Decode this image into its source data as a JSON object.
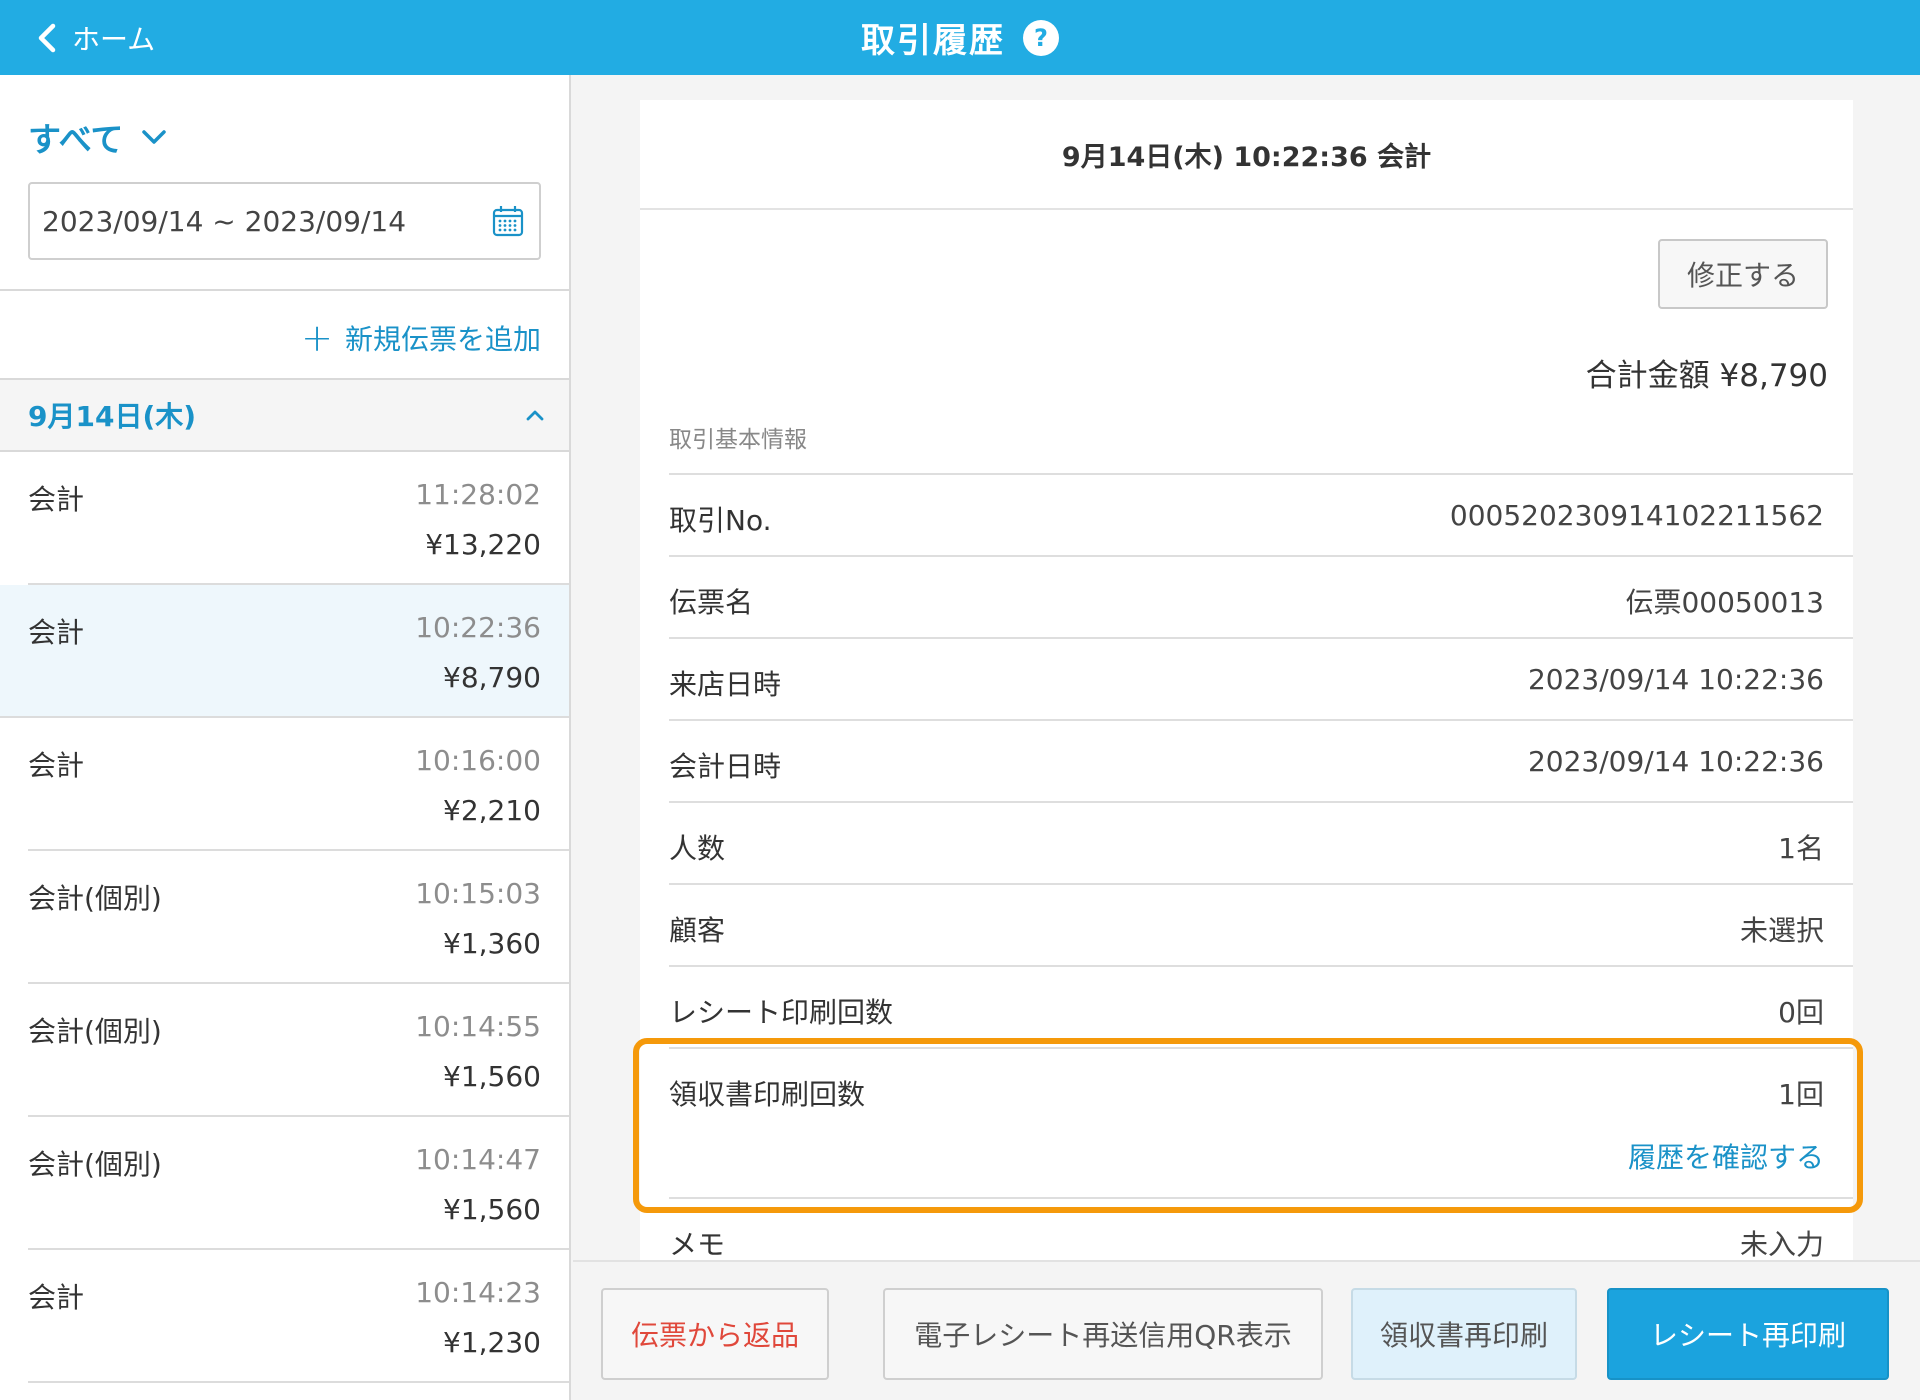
{
  "header": {
    "back_label": "ホーム",
    "title": "取引履歴",
    "help_symbol": "?"
  },
  "sidebar": {
    "filter_label": "すべて",
    "date_range": "2023/09/14 ~ 2023/09/14",
    "add_slip_label": "新規伝票を追加",
    "date_group_label": "9月14日(木)",
    "transactions": [
      {
        "name": "会計",
        "time": "11:28:02",
        "amount": "¥13,220",
        "selected": false
      },
      {
        "name": "会計",
        "time": "10:22:36",
        "amount": "¥8,790",
        "selected": true
      },
      {
        "name": "会計",
        "time": "10:16:00",
        "amount": "¥2,210",
        "selected": false
      },
      {
        "name": "会計(個別)",
        "time": "10:15:03",
        "amount": "¥1,360",
        "selected": false
      },
      {
        "name": "会計(個別)",
        "time": "10:14:55",
        "amount": "¥1,560",
        "selected": false
      },
      {
        "name": "会計(個別)",
        "time": "10:14:47",
        "amount": "¥1,560",
        "selected": false
      },
      {
        "name": "会計",
        "time": "10:14:23",
        "amount": "¥1,230",
        "selected": false
      }
    ]
  },
  "detail": {
    "title": "9月14日(木) 10:22:36 会計",
    "edit_label": "修正する",
    "total_label": "合計金額 ¥8,790",
    "section_label": "取引基本情報",
    "rows": [
      {
        "key": "取引No.",
        "value": "00052023091410221 1562"
      },
      {
        "key": "伝票名",
        "value": "伝票00050013"
      },
      {
        "key": "来店日時",
        "value": "2023/09/14 10:22:36"
      },
      {
        "key": "会計日時",
        "value": "2023/09/14 10:22:36"
      },
      {
        "key": "人数",
        "value": "1名"
      },
      {
        "key": "顧客",
        "value": "未選択"
      },
      {
        "key": "レシート印刷回数",
        "value": "0回"
      }
    ],
    "receipt_row": {
      "key": "領収書印刷回数",
      "value": "1回",
      "link": "履歴を確認する"
    },
    "memo_row": {
      "key": "メモ",
      "value": "未入力"
    },
    "highlight_color": "#f5990a"
  },
  "actions": {
    "return_label": "伝票から返品",
    "qr_label": "電子レシート再送信用QR表示",
    "receipt_reprint_label": "領収書再印刷",
    "reprint_label": "レシート再印刷"
  },
  "colors": {
    "header": "#22ace3",
    "accent": "#1a92c8",
    "danger": "#e0483b",
    "primary_button": "#1ba3de"
  }
}
